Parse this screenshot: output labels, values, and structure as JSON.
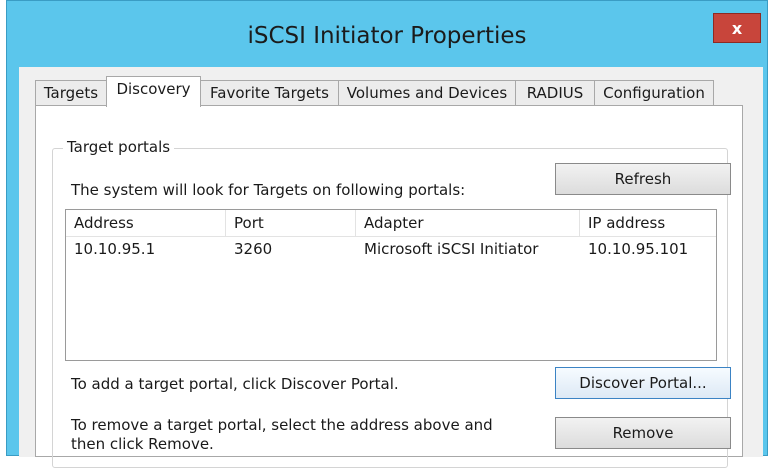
{
  "window": {
    "title": "iSCSI Initiator Properties",
    "close_glyph": "x"
  },
  "tabs": [
    {
      "label": "Targets",
      "active": false
    },
    {
      "label": "Discovery",
      "active": true
    },
    {
      "label": "Favorite Targets",
      "active": false
    },
    {
      "label": "Volumes and Devices",
      "active": false
    },
    {
      "label": "RADIUS",
      "active": false
    },
    {
      "label": "Configuration",
      "active": false
    }
  ],
  "target_portals": {
    "group_label": "Target portals",
    "intro": "The system will look for Targets on following portals:",
    "refresh_label": "Refresh",
    "columns": [
      "Address",
      "Port",
      "Adapter",
      "IP address"
    ],
    "rows": [
      {
        "address": "10.10.95.1",
        "port": "3260",
        "adapter": "Microsoft iSCSI Initiator",
        "ip": "10.10.95.101"
      }
    ],
    "add_hint": "To add a target portal, click Discover Portal.",
    "discover_label": "Discover Portal...",
    "remove_hint_line1": "To remove a target portal, select the address above and",
    "remove_hint_line2": "then click Remove.",
    "remove_label": "Remove"
  },
  "colors": {
    "title_bar": "#5bc6ec",
    "close_button": "#c8453b",
    "panel": "#ffffff"
  }
}
